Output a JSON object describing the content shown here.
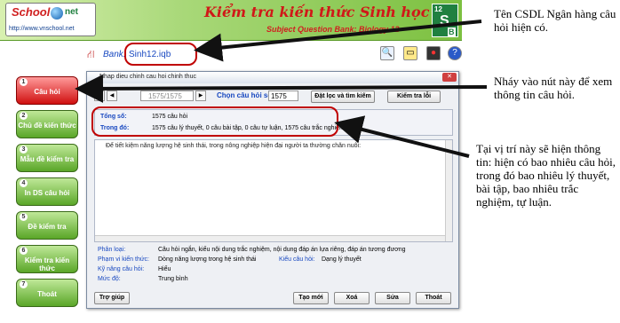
{
  "header": {
    "logo_text": "School",
    "logo_suffix": "net",
    "logo_url": "http://www.vnschool.net",
    "title": "Kiểm tra kiến thức Sinh học 12",
    "subtitle": "Subject Question Bank: Biology 12",
    "badge": {
      "num": "12",
      "letter": "S",
      "sub": "B"
    }
  },
  "bank": {
    "label": "Bank:",
    "value": "Sinh12.iqb"
  },
  "toolbar": {
    "icons": [
      "search-icon",
      "folder-icon",
      "traffic-light-icon",
      "help-icon"
    ]
  },
  "sidebar": {
    "items": [
      {
        "num": "1",
        "label": "Câu hỏi"
      },
      {
        "num": "2",
        "label": "Chủ đề kiến thức"
      },
      {
        "num": "3",
        "label": "Mẫu đề kiểm tra"
      },
      {
        "num": "4",
        "label": "In DS câu hỏi"
      },
      {
        "num": "5",
        "label": "Đề kiểm tra"
      },
      {
        "num": "6",
        "label": "Kiểm tra kiến thức"
      },
      {
        "num": "7",
        "label": "Thoát"
      }
    ]
  },
  "dialog": {
    "title": "Nhap dieu chinh cau hoi chinh thuc",
    "record": "1575/1575",
    "choose_label": "Chọn câu hỏi số:",
    "choose_value": "1575",
    "filter_button": "Đặt lọc và tìm kiếm",
    "test_button": "Kiểm tra lỗi",
    "total_label": "Tổng số:",
    "total_value": "1575 câu hỏi",
    "breakdown_label": "Trong đó:",
    "breakdown_value": "1575 câu lý thuyết, 0 câu bài tập, 0 câu tự luận, 1575 câu trắc nghiệm",
    "question_text": "Để tiết kiệm năng lượng hệ sinh thái, trong nông nghiệp hiện đại người ta thường chăn nuôi:",
    "meta": {
      "type_label": "Phân loại:",
      "type_value": "Câu hỏi ngắn, kiểu nội dung trắc nghiệm, nội dung đáp án lựa riêng, đáp án tương đương",
      "scope_label": "Phạm vi kiến thức:",
      "scope_value": "Dòng năng lượng trong hệ sinh thái",
      "qtype_label": "Kiểu câu hỏi:",
      "qtype_value": "Dạng lý thuyết",
      "skill_label": "Kỹ năng câu hỏi:",
      "skill_value": "Hiểu",
      "level_label": "Mức độ:",
      "level_value": "Trung bình"
    },
    "buttons": {
      "help": "Trợ giúp",
      "new": "Tạo mới",
      "delete": "Xoá",
      "edit": "Sửa",
      "exit": "Thoát"
    }
  },
  "annotations": {
    "a1": "Tên CSDL Ngân hàng câu hỏi hiện có.",
    "a2": "Nháy vào nút này để xem thông tin câu hỏi.",
    "a3": "Tại vị trí này sẽ hiện thông tin: hiện có bao nhiêu câu hỏi, trong đó bao nhiêu lý thuyết, bài tập, bao nhiêu trắc nghiệm, tự luận."
  },
  "colors": {
    "highlight": "#c00000",
    "accent": "#1848c0",
    "header_green": "#7cc040"
  }
}
